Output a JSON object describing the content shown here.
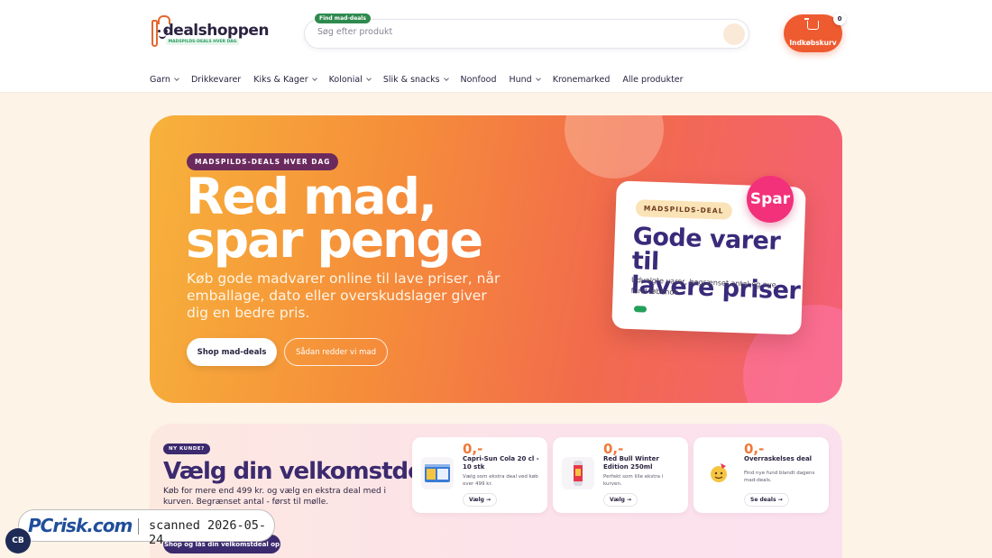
{
  "header": {
    "logo": {
      "name": "dealshoppen",
      "tagline": "MADSPILDS-DEALS HVER DAG"
    },
    "search": {
      "badge": "Find mad-deals",
      "placeholder": "Søg efter produkt"
    },
    "cart": {
      "label": "Indkøbskurv",
      "count": "0"
    }
  },
  "nav": {
    "items": [
      {
        "label": "Garn",
        "has_dropdown": true
      },
      {
        "label": "Drikkevarer",
        "has_dropdown": false
      },
      {
        "label": "Kiks & Kager",
        "has_dropdown": true
      },
      {
        "label": "Kolonial",
        "has_dropdown": true
      },
      {
        "label": "Slik & snacks",
        "has_dropdown": true
      },
      {
        "label": "Nonfood",
        "has_dropdown": false
      },
      {
        "label": "Hund",
        "has_dropdown": true
      },
      {
        "label": "Kronemarked",
        "has_dropdown": false
      },
      {
        "label": "Alle produkter",
        "has_dropdown": false
      }
    ]
  },
  "hero": {
    "pill": "MADSPILDS-DEALS HVER DAG",
    "title_line1": "Red mad,",
    "title_line2": "spar penge",
    "subtitle": "Køb gode madvarer online til lave priser, når emballage, dato eller overskudslager giver dig en bedre pris.",
    "primary_button": "Shop mad-deals",
    "secondary_button": "Sådan redder vi mad",
    "card": {
      "pill": "MADSPILDS-DEAL",
      "title_line1": "Gode varer til",
      "title_line2": "lavere priser",
      "text": "Udvalgte varer, begrænset antal og nye fund løbende.",
      "badge": "Spar"
    }
  },
  "welcome": {
    "pill": "NY KUNDE?",
    "title": "Vælg din velkomstdeal",
    "text": "Køb for mere end 499 kr. og vælg en ekstra deal med i kurven. Begrænset antal - først til mølle.",
    "button": "Shop og lås din velkomstdeal op",
    "offers": [
      {
        "price": "0,-",
        "name": "Capri-Sun Cola 20 cl - 10 stk",
        "desc": "Vælg som ekstra deal ved køb over 499 kr.",
        "button": "Vælg",
        "icon": "juice-box-icon"
      },
      {
        "price": "0,-",
        "name": "Red Bull Winter Edition 250ml",
        "desc": "Perfekt som lille ekstra i kurven.",
        "button": "Vælg",
        "icon": "energy-can-icon"
      },
      {
        "price": "0,-",
        "name": "Overraskelses deal",
        "desc": "Find nye fund blandt dagens mad-deals.",
        "button": "Se deals",
        "icon": "party-face-icon"
      }
    ]
  },
  "overlay": {
    "watermark_logo": "PCrisk.com",
    "watermark_scan": "scanned 2026-05-24",
    "cookie_label": "CB"
  },
  "colors": {
    "accent": "#ee5b30",
    "brand_dark": "#3b2a6e",
    "green": "#2f8a4f",
    "pink": "#f2317a"
  }
}
